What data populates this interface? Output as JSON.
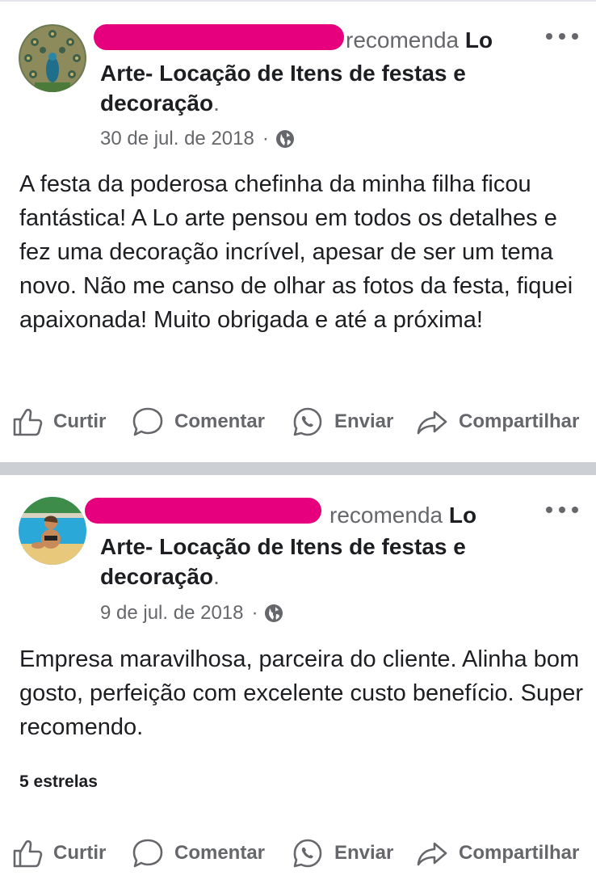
{
  "posts": [
    {
      "recommends": "recomenda",
      "page_name_start": "Lo",
      "page_name_rest": "Arte- Locação de Itens de festas e decoração",
      "date": "30 de jul. de 2018",
      "separator": "·",
      "text": "A festa da poderosa chefinha da minha filha ficou fantástica! A Lo arte pensou em todos os detalhes e fez uma decoração incrível, apesar de ser um tema novo. Não me canso de olhar as fotos da festa, fiquei apaixonada! Muito obrigada e até a próxima!",
      "avatar_icon": "peacock-avatar",
      "privacy_icon": "globe-icon"
    },
    {
      "recommends": "recomenda",
      "page_name_start": "Lo",
      "page_name_rest": "Arte- Locação de Itens de festas e decoração",
      "date": "9 de jul. de 2018",
      "separator": "·",
      "text": "Empresa maravilhosa, parceira do cliente. Alinha bom gosto, perfeição com excelente custo benefício. Super recomendo.",
      "rating_label": "5 estrelas",
      "avatar_icon": "pool-avatar",
      "privacy_icon": "globe-icon"
    }
  ],
  "actions": {
    "like": "Curtir",
    "comment": "Comentar",
    "send": "Enviar",
    "share": "Compartilhar"
  },
  "colors": {
    "redaction": "#e6007e",
    "secondary_text": "#65676b",
    "separator": "#ccd0d5"
  }
}
